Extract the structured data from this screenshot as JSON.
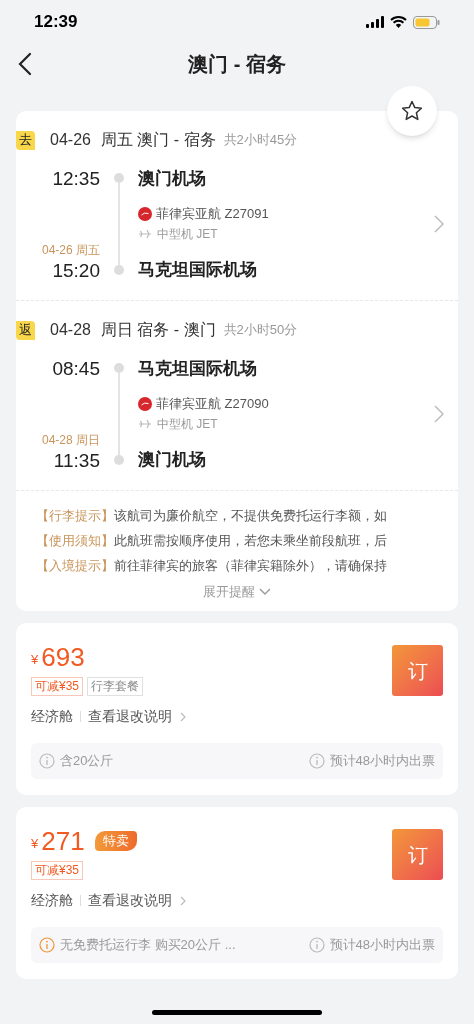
{
  "status_bar": {
    "time": "12:39"
  },
  "nav": {
    "title": "澳门 - 宿务"
  },
  "favorite": {
    "selected": false
  },
  "legs": [
    {
      "tag": "去",
      "date": "04-26",
      "day_route": "周五 澳门 - 宿务",
      "duration": "共2小时45分",
      "dep_time": "12:35",
      "dep_airport": "澳门机场",
      "airline": "菲律宾亚航 Z27091",
      "aircraft": "中型机 JET",
      "arr_date": "04-26 周五",
      "arr_time": "15:20",
      "arr_airport": "马克坦国际机场"
    },
    {
      "tag": "返",
      "date": "04-28",
      "day_route": "周日 宿务 - 澳门",
      "duration": "共2小时50分",
      "dep_time": "08:45",
      "dep_airport": "马克坦国际机场",
      "airline": "菲律宾亚航 Z27090",
      "aircraft": "中型机 JET",
      "arr_date": "04-28 周日",
      "arr_time": "11:35",
      "arr_airport": "澳门机场"
    }
  ],
  "notes": [
    {
      "label": "【行李提示】",
      "text": "该航司为廉价航空，不提供免费托运行李额，如"
    },
    {
      "label": "【使用须知】",
      "text": "此航班需按顺序使用，若您未乘坐前段航班，后"
    },
    {
      "label": "【入境提示】",
      "text": "前往菲律宾的旅客（菲律宾籍除外），请确保持"
    }
  ],
  "expand": {
    "label": "展开提醒",
    "expanded": false
  },
  "fares": [
    {
      "currency": "¥",
      "price": "693",
      "tags": [
        {
          "kind": "discount",
          "text": "可减¥35"
        },
        {
          "kind": "plain",
          "text": "行李套餐"
        }
      ],
      "cabin": "经济舱",
      "rules_link": "查看退改说明",
      "book": "订",
      "baggage": {
        "text": "含20公斤",
        "warn": false
      },
      "ticketing": "预计48小时内出票"
    },
    {
      "currency": "¥",
      "price": "271",
      "special": "特卖",
      "tags": [
        {
          "kind": "discount",
          "text": "可减¥35"
        }
      ],
      "cabin": "经济舱",
      "rules_link": "查看退改说明",
      "book": "订",
      "baggage": {
        "text": "无免费托运行李 购买20公斤 ...",
        "warn": true
      },
      "ticketing": "预计48小时内出票"
    }
  ]
}
